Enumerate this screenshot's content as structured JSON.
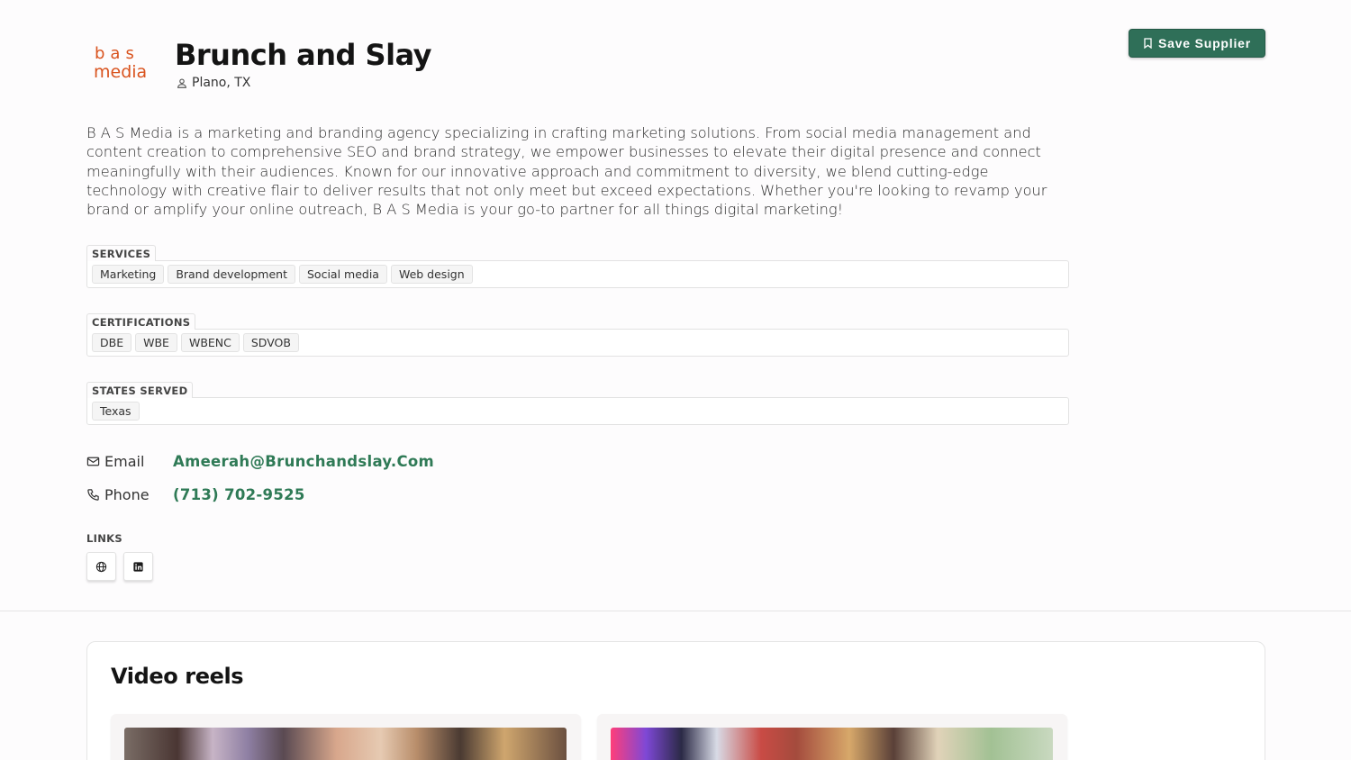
{
  "company": {
    "logo_line1": "bas",
    "logo_line2": "media",
    "name": "Brunch and Slay",
    "location": "Plano, TX",
    "description": "B A S Media is a marketing and branding agency specializing in crafting marketing solutions. From social media management and content creation to comprehensive SEO and brand strategy, we empower businesses to elevate their digital presence and connect meaningfully with their audiences. Known for our innovative approach and commitment to diversity, we blend cutting-edge technology with creative flair to deliver results that not only meet but exceed expectations. Whether you're looking to revamp your brand or amplify your online outreach, B A S Media is your go-to partner for all things digital marketing!"
  },
  "actions": {
    "save_label": "Save Supplier"
  },
  "services": {
    "label": "SERVICES",
    "tags": [
      "Marketing",
      "Brand development",
      "Social media",
      "Web design"
    ]
  },
  "certifications": {
    "label": "CERTIFICATIONS",
    "tags": [
      "DBE",
      "WBE",
      "WBENC",
      "SDVOB"
    ]
  },
  "states": {
    "label": "STATES SERVED",
    "tags": [
      "Texas"
    ]
  },
  "contact": {
    "email_label": "Email",
    "email": "Ameerah@Brunchandslay.Com",
    "phone_label": "Phone",
    "phone": "(713) 702-9525"
  },
  "links": {
    "label": "LINKS",
    "items": [
      "globe-icon",
      "linkedin-icon"
    ]
  },
  "reels": {
    "title": "Video reels"
  },
  "colors": {
    "accent": "#2f6f58",
    "link": "#2f7a56",
    "logo": "#d9531e"
  }
}
